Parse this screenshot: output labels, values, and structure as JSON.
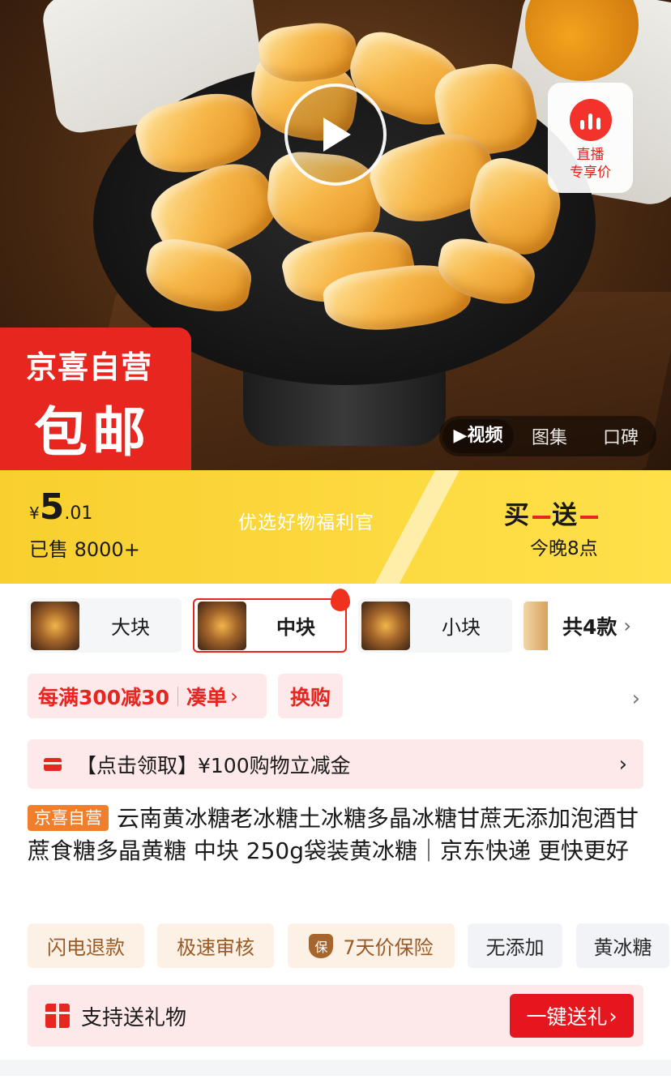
{
  "hero": {
    "live_label_line1": "直播",
    "live_label_line2": "专享价",
    "badge_top": "京喜自营",
    "badge_main": "包邮",
    "media_tabs": [
      {
        "label": "▶视频",
        "active": true
      },
      {
        "label": "图集",
        "active": false
      },
      {
        "label": "口碑",
        "active": false
      }
    ]
  },
  "price_banner": {
    "currency": "¥",
    "price_int": "5",
    "price_dec": ".01",
    "sold": "已售 8000+",
    "slogan": "优选好物福利官",
    "promo_a": "买",
    "promo_b": "送",
    "promo_time": "今晚8点"
  },
  "skus": {
    "items": [
      {
        "label": "大块",
        "selected": false
      },
      {
        "label": "中块",
        "selected": true
      },
      {
        "label": "小块",
        "selected": false
      }
    ],
    "more_label": "共4款"
  },
  "coupons": {
    "discount": "每满300减30",
    "combine": "凑单",
    "exchange": "换购"
  },
  "voucher": {
    "text": "【点击领取】¥100购物立减金"
  },
  "product": {
    "tag": "京喜自营",
    "title": "云南黄冰糖老冰糖土冰糖多晶冰糖甘蔗无添加泡酒甘蔗食糖多晶黄糖 中块 250g袋装黄冰糖｜京东快递 更快更好"
  },
  "chips": {
    "items": [
      "闪电退款",
      "极速审核",
      "7天价保险",
      "无添加",
      "黄冰糖"
    ],
    "shield_glyph": "保"
  },
  "gift": {
    "text": "支持送礼物",
    "button": "一键送礼"
  },
  "colors": {
    "brand_red": "#e6261f",
    "banner_yellow": "#fcd93f",
    "tag_orange": "#f07e2a"
  }
}
